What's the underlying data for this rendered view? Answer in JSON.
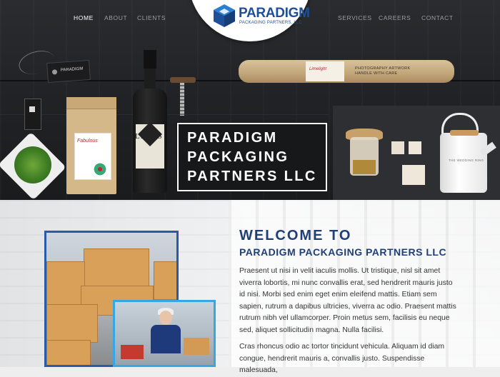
{
  "nav": {
    "left": [
      "HOME",
      "ABOUT",
      "CLIENTS"
    ],
    "right": [
      "SERVICES",
      "CAREERS",
      "CONTACT"
    ],
    "active": "HOME"
  },
  "logo": {
    "title": "PARADIGM",
    "subtitle": "PACKAGING PARTNERS, LLC"
  },
  "hero": {
    "lines": [
      "PARADIGM",
      "PACKAGING",
      "PARTNERS LLC"
    ],
    "props": {
      "tag_text": "PARADIGM",
      "bag_label": "Fabulous",
      "bottle_label": "LEWIS",
      "tube_label": "Limelight",
      "tube_text": [
        "PHOTOGRAPHY ARTWORK",
        "HANDLE WITH CARE"
      ],
      "kettle_label": "THE WEDDING RING"
    }
  },
  "welcome": {
    "title": "WELCOME TO",
    "subtitle": "PARADIGM PACKAGING PARTNERS LLC",
    "paragraphs": [
      "Praesent ut nisi in velit iaculis mollis. Ut tristique, nisl sit amet viverra lobortis, mi nunc convallis erat, sed hendrerit mauris justo id nisi. Morbi sed enim eget enim eleifend mattis. Etiam sem sapien, rutrum a dapibus ultricies, viverra ac odio. Praesent mattis rutrum nibh vel ullamcorper. Proin metus sem, facilisis eu neque sed, aliquet sollicitudin magna. Nulla facilisi.",
      "Cras rhoncus odio ac tortor tincidunt vehicula. Aliquam id diam congue, hendrerit mauris a, convallis justo. Suspendisse malesuada,"
    ]
  },
  "colors": {
    "brand_blue": "#1d4f9a",
    "heading_navy": "#1f3f76",
    "photo_border_dark": "#2a5aa8",
    "photo_border_light": "#35a6e6",
    "hero_bg": "#242528"
  }
}
